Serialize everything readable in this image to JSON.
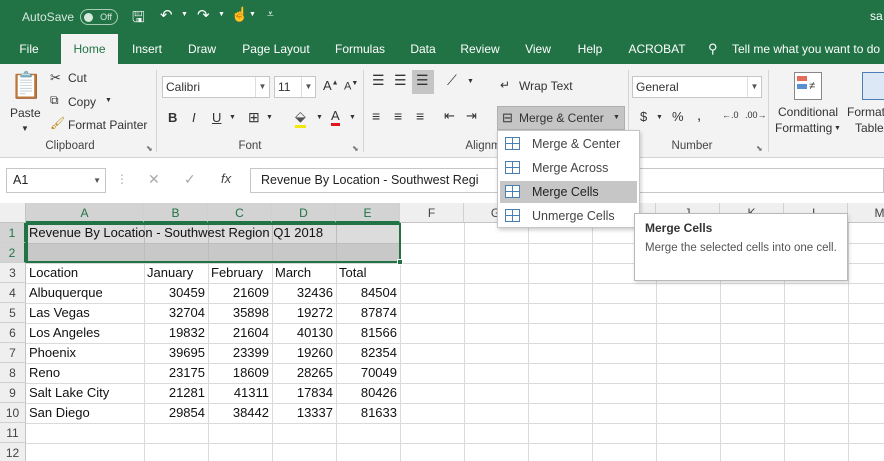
{
  "titlebar": {
    "autosave_label": "AutoSave",
    "autosave_state": "Off",
    "user_fragment": "sa"
  },
  "tabs": [
    {
      "label": "File"
    },
    {
      "label": "Home"
    },
    {
      "label": "Insert"
    },
    {
      "label": "Draw"
    },
    {
      "label": "Page Layout"
    },
    {
      "label": "Formulas"
    },
    {
      "label": "Data"
    },
    {
      "label": "Review"
    },
    {
      "label": "View"
    },
    {
      "label": "Help"
    },
    {
      "label": "ACROBAT"
    }
  ],
  "tell_me": "Tell me what you want to do",
  "ribbon": {
    "clipboard": {
      "paste": "Paste",
      "cut": "Cut",
      "copy": "Copy",
      "format_painter": "Format Painter",
      "label": "Clipboard"
    },
    "font": {
      "name": "Calibri",
      "size": "11",
      "bold": "B",
      "italic": "I",
      "underline": "U",
      "label": "Font"
    },
    "alignment": {
      "wrap_text": "Wrap Text",
      "merge_center": "Merge & Center",
      "label": "Alignm"
    },
    "number": {
      "format": "General",
      "currency": "$",
      "percent": "%",
      "comma": ",",
      "label": "Number"
    },
    "styles": {
      "conditional_line1": "Conditional",
      "conditional_line2": "Formatting",
      "format_table_line1": "Format",
      "format_table_line2": "Table"
    }
  },
  "formula_bar": {
    "name_box": "A1",
    "fx": "fx",
    "content": "Revenue By Location - Southwest Regi"
  },
  "columns": [
    "A",
    "B",
    "C",
    "D",
    "E",
    "F",
    "G",
    "H",
    "I",
    "J",
    "K",
    "L",
    "M"
  ],
  "rows": [
    "1",
    "2",
    "3",
    "4",
    "5",
    "6",
    "7",
    "8",
    "9",
    "10",
    "11",
    "12"
  ],
  "sheet": {
    "title": "Revenue By Location - Southwest Region Q1 2018",
    "headers": [
      "Location",
      "January",
      "February",
      "March",
      "Total"
    ],
    "data": [
      [
        "Albuquerque",
        "30459",
        "21609",
        "32436",
        "84504"
      ],
      [
        "Las Vegas",
        "32704",
        "35898",
        "19272",
        "87874"
      ],
      [
        "Los Angeles",
        "19832",
        "21604",
        "40130",
        "81566"
      ],
      [
        "Phoenix",
        "39695",
        "23399",
        "19260",
        "82354"
      ],
      [
        "Reno",
        "23175",
        "18609",
        "28265",
        "70049"
      ],
      [
        "Salt Lake City",
        "21281",
        "41311",
        "17834",
        "80426"
      ],
      [
        "San Diego",
        "29854",
        "38442",
        "13337",
        "81633"
      ]
    ]
  },
  "dropdown": {
    "items": [
      {
        "label": "Merge & Center"
      },
      {
        "label": "Merge Across"
      },
      {
        "label": "Merge Cells"
      },
      {
        "label": "Unmerge Cells"
      }
    ]
  },
  "tooltip": {
    "title": "Merge Cells",
    "description": "Merge the selected cells into one cell."
  },
  "colors": {
    "excel_green": "#217346",
    "ribbon_bg": "#f3f3f3",
    "selection_gray": "#c8c8c8"
  }
}
